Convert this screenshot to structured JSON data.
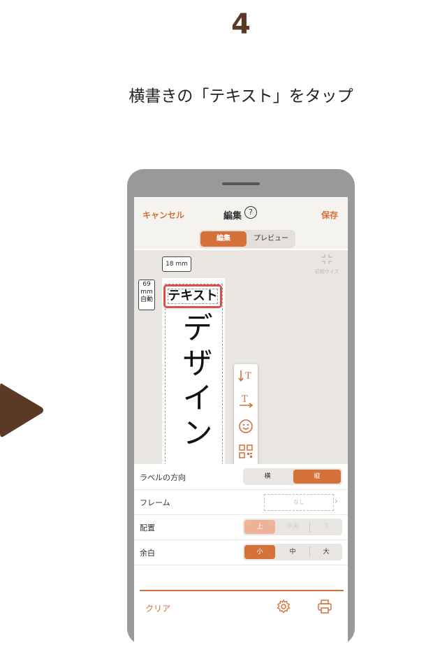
{
  "step_number": "4",
  "instruction": "横書きの「テキスト」をタップ",
  "colors": {
    "accent": "#d4703a",
    "highlight": "#e24c44",
    "arrow": "#5a3a26"
  },
  "nav": {
    "cancel": "キャンセル",
    "title": "編集",
    "help": "?",
    "save": "保存"
  },
  "tabs": {
    "edit": "編集",
    "preview": "プレビュー"
  },
  "canvas": {
    "width_label": "18 mm",
    "length_value": "69",
    "length_unit": "mm",
    "length_mode": "自動",
    "reset_label": "初期サイズ",
    "text_object": "テキスト",
    "vertical_text": "デザイン"
  },
  "toolbox": {
    "icons": [
      "vertical-text-icon",
      "horizontal-text-icon",
      "emoji-icon",
      "qr-code-icon"
    ],
    "more": "▼"
  },
  "settings": {
    "direction": {
      "label": "ラベルの方向",
      "options": [
        "横",
        "縦"
      ],
      "selected": "縦"
    },
    "frame": {
      "label": "フレーム",
      "value": "なし"
    },
    "align": {
      "label": "配置",
      "options": [
        "上",
        "中央",
        "下"
      ],
      "selected": "上"
    },
    "margin": {
      "label": "余白",
      "options": [
        "小",
        "中",
        "大"
      ],
      "selected": "小"
    }
  },
  "footer": {
    "clear": "クリア",
    "settings_icon": "gear-icon",
    "print_icon": "print-icon"
  }
}
